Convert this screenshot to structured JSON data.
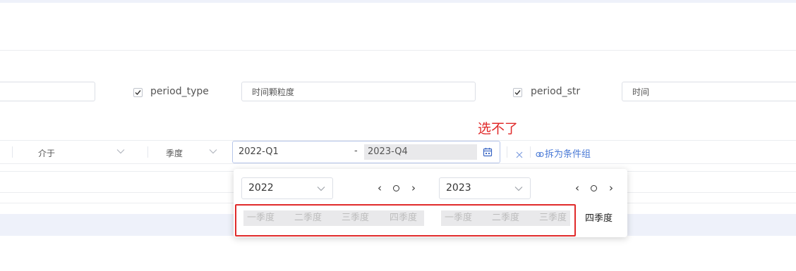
{
  "filters": {
    "period_type": {
      "label": "period_type",
      "value": "时间颗粒度",
      "checked": true
    },
    "period_str": {
      "label": "period_str",
      "value": "时间",
      "checked": true
    }
  },
  "annotation": {
    "text": "选不了",
    "color": "#e02a2a"
  },
  "condition": {
    "operator": "介于",
    "granularity": "季度",
    "range_start": "2022-Q1",
    "range_separator": "-",
    "range_end": "2023-Q4",
    "split_link": "拆为条件组"
  },
  "picker": {
    "left": {
      "year": "2022",
      "quarters": [
        "一季度",
        "二季度",
        "三季度",
        "四季度"
      ]
    },
    "right": {
      "year": "2023",
      "quarters": [
        "一季度",
        "二季度",
        "三季度",
        "四季度"
      ]
    },
    "nav": {
      "prev": "‹",
      "next": "›"
    }
  },
  "colors": {
    "accent": "#4a7ad6",
    "annotation": "#e02a2a",
    "disabled_bg": "#e9e9eb"
  }
}
